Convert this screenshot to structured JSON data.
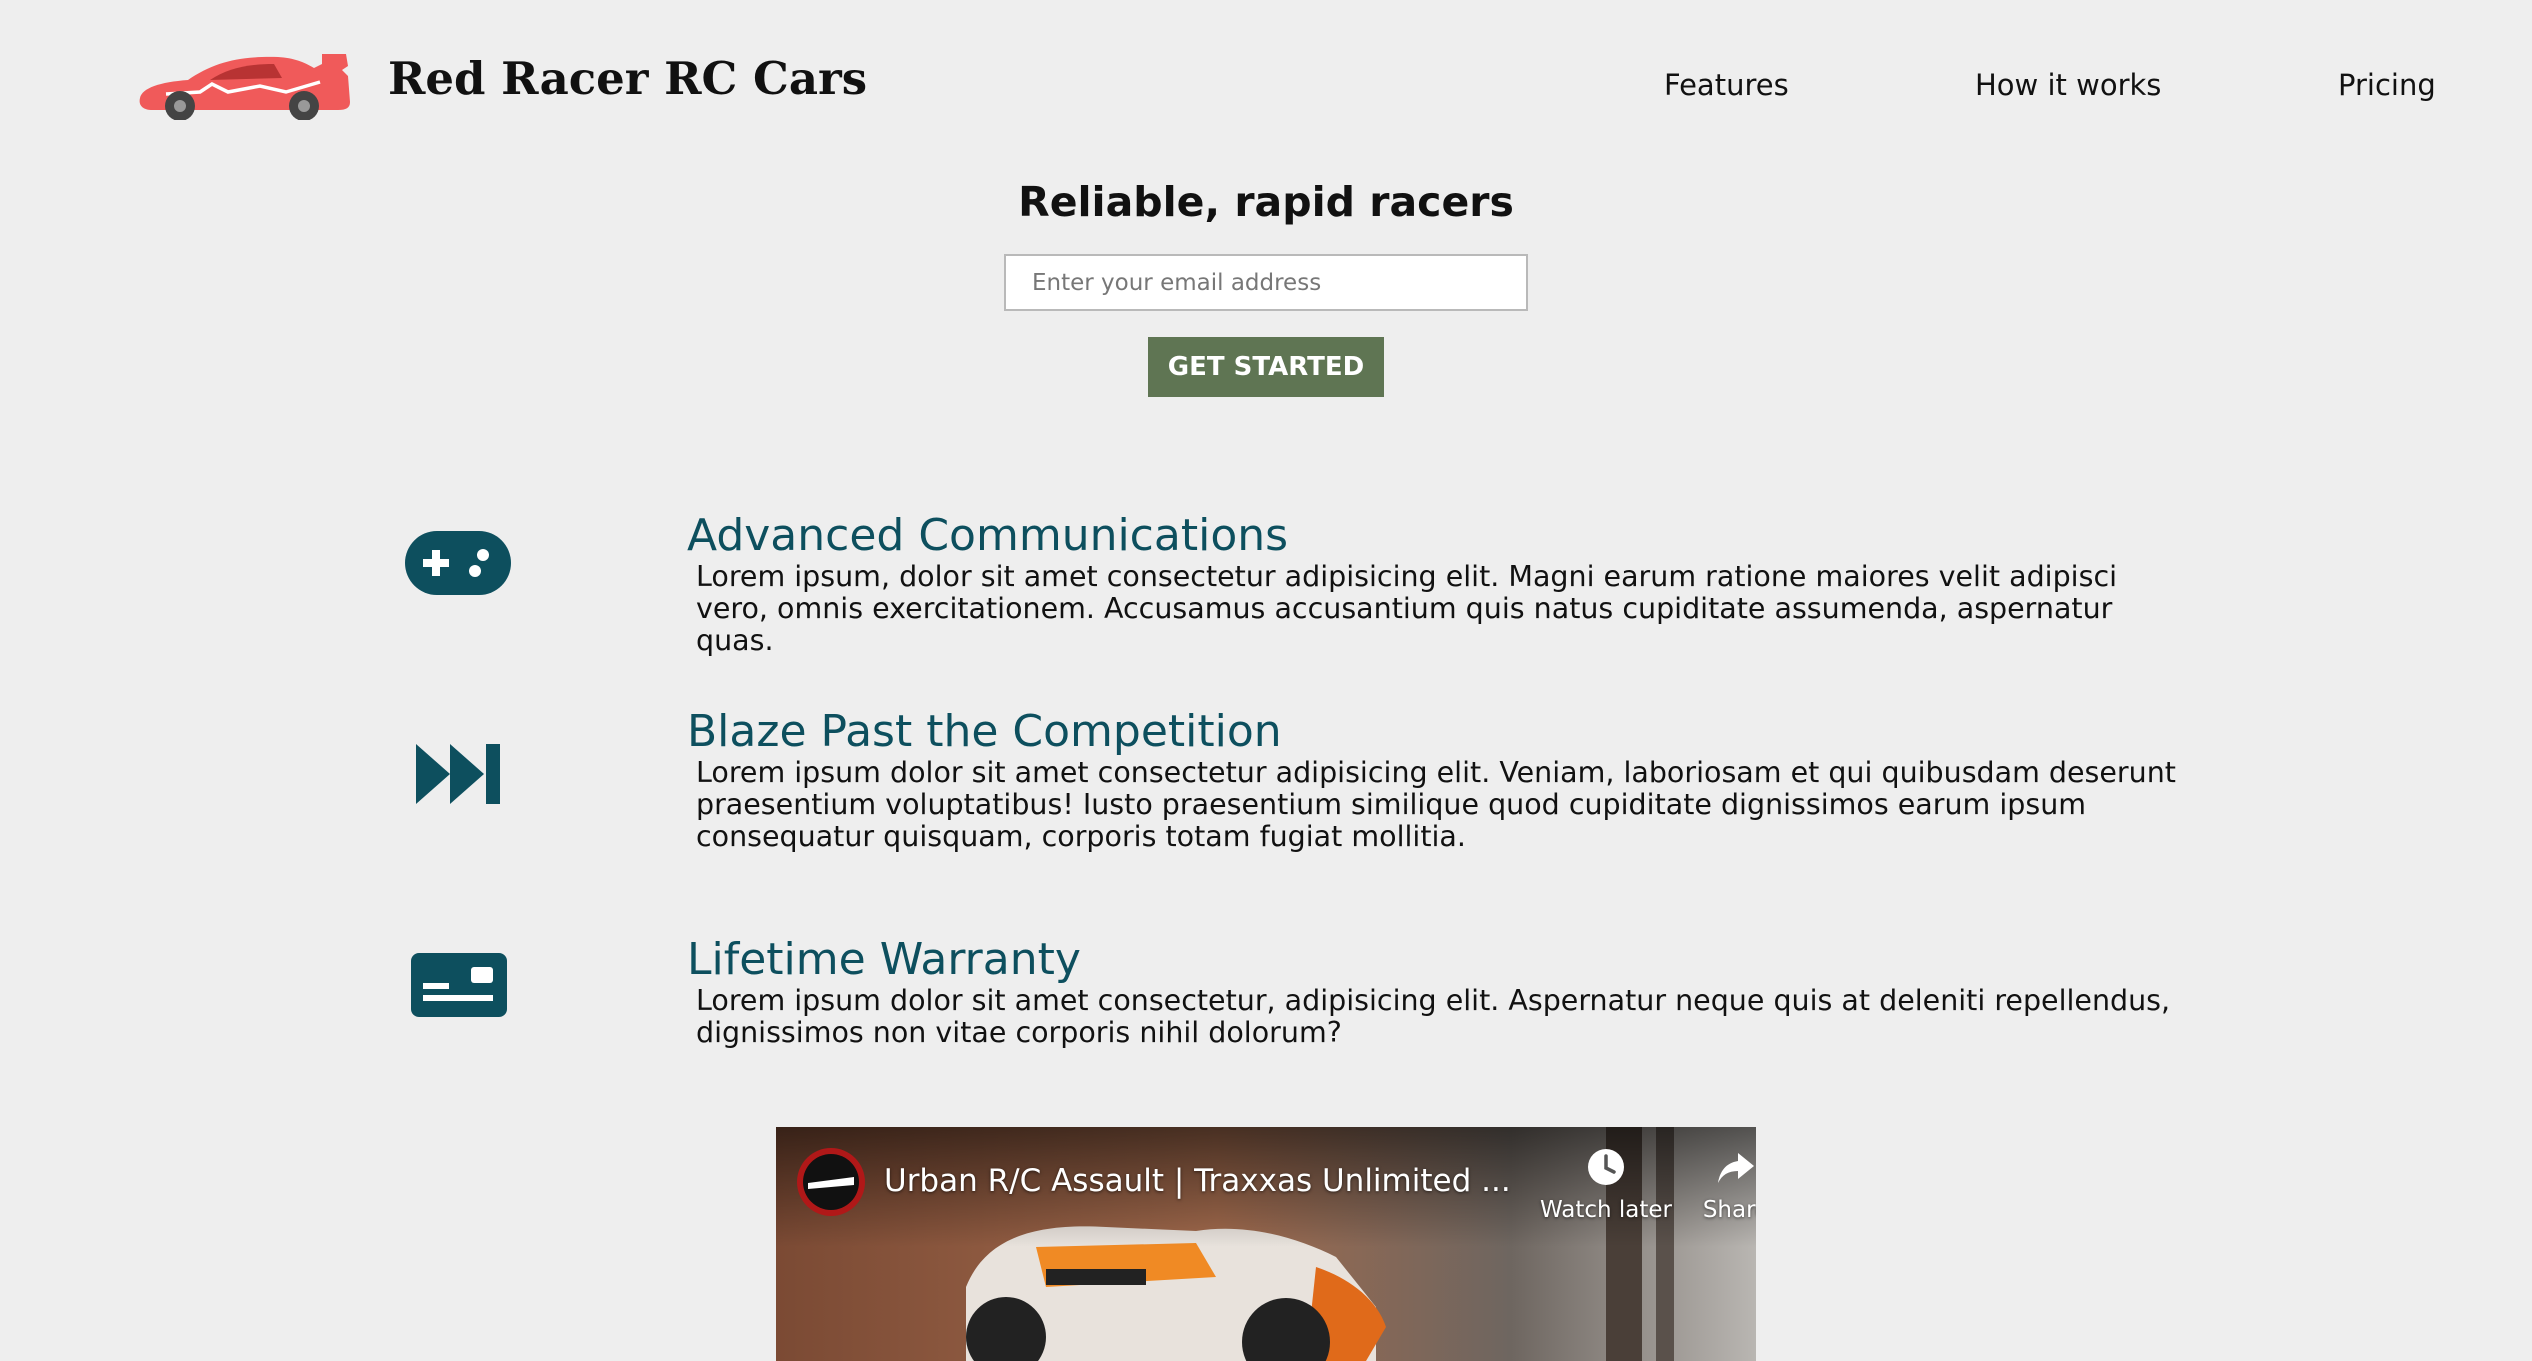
{
  "header": {
    "brand": "Red Racer RC Cars",
    "logo_icon": "race-car-icon",
    "nav": [
      {
        "label": "Features"
      },
      {
        "label": "How it works"
      },
      {
        "label": "Pricing"
      }
    ]
  },
  "hero": {
    "title": "Reliable, rapid racers",
    "email_placeholder": "Enter your email address",
    "cta_label": "GET STARTED"
  },
  "features": [
    {
      "icon": "gamepad-icon",
      "title": "Advanced Communications",
      "text": "Lorem ipsum, dolor sit amet consectetur adipisicing elit. Magni earum ratione maiores velit adipisci vero, omnis exercitationem. Accusamus accusantium quis natus cupiditate assumenda, aspernatur quas."
    },
    {
      "icon": "fast-forward-icon",
      "title": "Blaze Past the Competition",
      "text": "Lorem ipsum dolor sit amet consectetur adipisicing elit. Veniam, laboriosam et qui quibusdam deserunt praesentium voluptatibus! Iusto praesentium similique quod cupiditate dignissimos earum ipsum consequatur quisquam, corporis totam fugiat mollitia."
    },
    {
      "icon": "id-card-icon",
      "title": "Lifetime Warranty",
      "text": "Lorem ipsum dolor sit amet consectetur, adipisicing elit. Aspernatur neque quis at deleniti repellendus, dignissimos non vitae corporis nihil dolorum?"
    }
  ],
  "video": {
    "title": "Urban R/C Assault | Traxxas Unlimited ...",
    "watch_later_label": "Watch later",
    "share_label": "Share"
  },
  "colors": {
    "background": "#eeeeee",
    "accent_button": "#5f7553",
    "feature_teal": "#0d4f5e",
    "logo_red": "#f05a5a"
  }
}
